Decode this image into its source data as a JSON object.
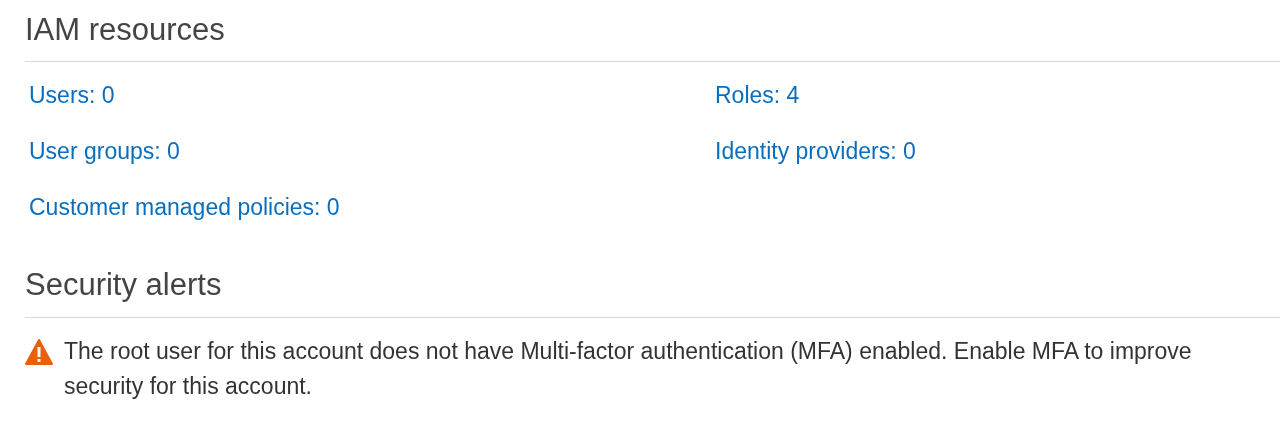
{
  "iam_resources": {
    "title": "IAM resources",
    "links": [
      {
        "label": "Users: 0"
      },
      {
        "label": "Roles: 4"
      },
      {
        "label": "User groups: 0"
      },
      {
        "label": "Identity providers: 0"
      },
      {
        "label": "Customer managed policies: 0"
      }
    ]
  },
  "security_alerts": {
    "title": "Security alerts",
    "alerts": [
      {
        "kind": "warning",
        "text": "The root user for this account does not have Multi-factor authentication (MFA) enabled. Enable MFA to improve security for this account."
      }
    ]
  }
}
